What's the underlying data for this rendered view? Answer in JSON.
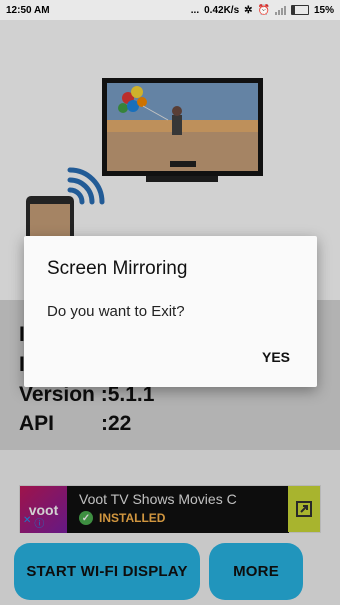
{
  "status_bar": {
    "time": "12:50 AM",
    "dots": "...",
    "speed": "0.42K/s",
    "battery": "15%"
  },
  "hero": {
    "tv_icon": "television-icon",
    "phone_icon": "smartphone-icon",
    "wifi_icon": "wifi-signal-icon"
  },
  "device_info": {
    "version_label": "Version :5.1.1",
    "api_label": "API",
    "api_value": ":22"
  },
  "ad": {
    "logo_text": "voot",
    "title": "Voot TV Shows Movies C",
    "installed": "INSTALLED",
    "brand_color": "#cddc39"
  },
  "buttons": {
    "start_wifi_display": "START WI-FI DISPLAY",
    "more": "MORE",
    "accent": "#29b6e6"
  },
  "dialog": {
    "title": "Screen Mirroring",
    "message": "Do you want to Exit?",
    "yes_label": "YES"
  }
}
